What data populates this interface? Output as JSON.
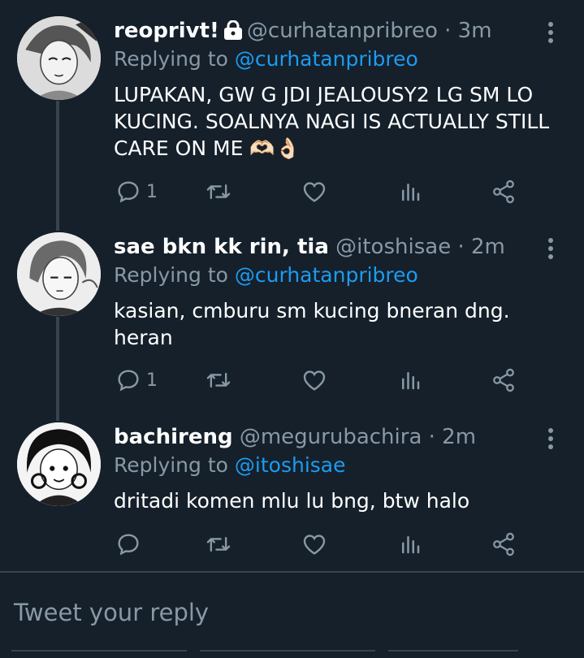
{
  "tweets": [
    {
      "name": "reoprivt!",
      "handle": "@curhatanpribreo",
      "separator": "·",
      "time": "3m",
      "replying_label": "Replying to",
      "replying_to": "@curhatanpribreo",
      "text": "LUPAKAN, GW G JDI JEALOUSY2 LG SM LO KUCING. SOALNYA NAGI IS ACTUALLY STILL CARE ON ME 🫶🏻👌🏻",
      "reply_count": "1",
      "protected_icon": "lock-icon"
    },
    {
      "name": "sae bkn kk rin, tia",
      "handle": "@itoshisae",
      "separator": "·",
      "time": "2m",
      "replying_label": "Replying to",
      "replying_to": "@curhatanpribreo",
      "text": "kasian, cmburu sm kucing bneran dng. heran",
      "reply_count": "1"
    },
    {
      "name": "bachireng",
      "handle": "@megurubachira",
      "separator": "·",
      "time": "2m",
      "replying_label": "Replying to",
      "replying_to": "@itoshisae",
      "text": "dritadi komen mlu lu bng, btw halo",
      "reply_count": ""
    }
  ],
  "action_icons": [
    "reply-icon",
    "retweet-icon",
    "like-icon",
    "analytics-icon",
    "share-icon"
  ],
  "compose": {
    "placeholder": "Tweet your reply"
  },
  "colors": {
    "background": "#15202b",
    "secondary_text": "#8899a6",
    "mention": "#1d9bf0",
    "divider": "#38444d"
  }
}
